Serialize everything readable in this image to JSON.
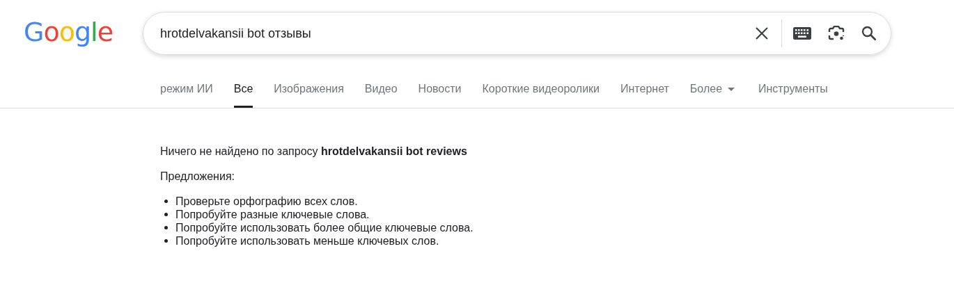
{
  "logo": {
    "text": "Google"
  },
  "search": {
    "value": "hrotdelvakansii bot отзывы"
  },
  "tabs": [
    {
      "label": "режим ИИ",
      "selected": false,
      "kind": "tab"
    },
    {
      "label": "Все",
      "selected": true,
      "kind": "tab"
    },
    {
      "label": "Изображения",
      "selected": false,
      "kind": "tab"
    },
    {
      "label": "Видео",
      "selected": false,
      "kind": "tab"
    },
    {
      "label": "Новости",
      "selected": false,
      "kind": "tab"
    },
    {
      "label": "Короткие видеоролики",
      "selected": false,
      "kind": "tab"
    },
    {
      "label": "Интернет",
      "selected": false,
      "kind": "tab"
    },
    {
      "label": "Более",
      "selected": false,
      "kind": "dropdown"
    }
  ],
  "tools": {
    "label": "Инструменты"
  },
  "result": {
    "message": "Ничего не найдено по запросу **hrotdelvakansii bot reviews**",
    "suggestions_title": "Предложения:",
    "suggestions": [
      "Проверьте орфографию всех слов.",
      "Попробуйте разные ключевые слова.",
      "Попробуйте использовать более общие ключевые слова.",
      "Попробуйте использовать меньше ключевых слов."
    ]
  }
}
